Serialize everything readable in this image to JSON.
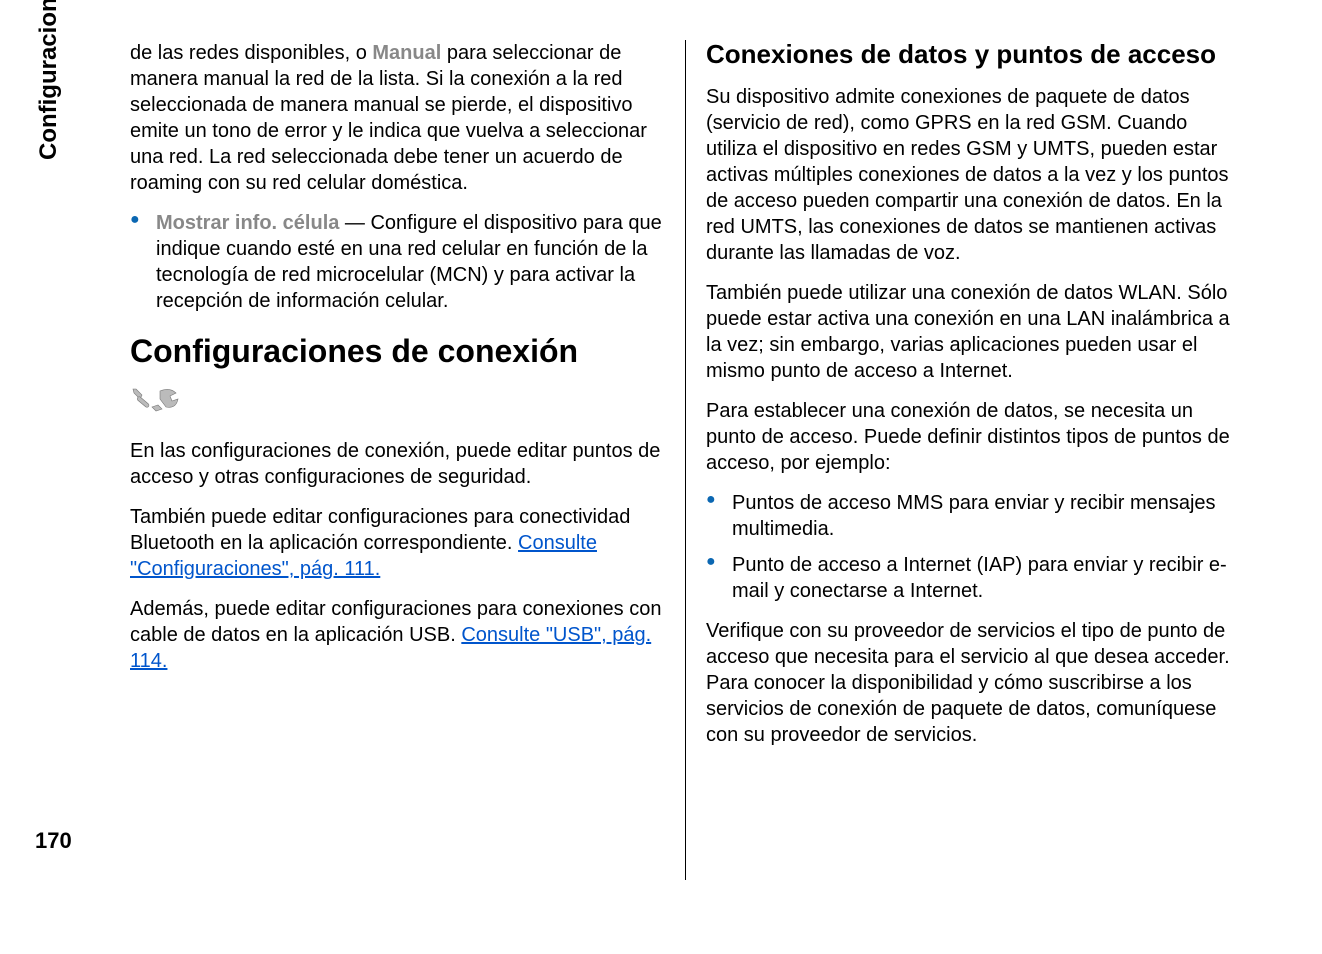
{
  "sideLabel": "Configuraciones",
  "pageNumber": "170",
  "left": {
    "introText1a": "de las redes disponibles, o ",
    "introManual": "Manual",
    "introText1b": " para seleccionar de manera manual la red de la lista. Si la conexión a la red seleccionada de manera manual se pierde, el dispositivo emite un tono de error y le indica que vuelva a seleccionar una red. La red seleccionada debe tener un acuerdo de roaming con su red celular doméstica.",
    "bullet1Label": "Mostrar info. célula",
    "bullet1Text": "  — Configure el dispositivo para que indique cuando esté en una red celular en función de la tecnología de red microcelular (MCN) y para activar la recepción de información celular.",
    "heading": "Configuraciones de conexión",
    "p1": "En las configuraciones de conexión, puede editar puntos de acceso y otras configuraciones de seguridad.",
    "p2a": "También puede editar configuraciones para conectividad Bluetooth en la aplicación correspondiente. ",
    "p2link": "Consulte \"Configuraciones\", pág. 111.",
    "p3a": "Además, puede editar configuraciones para conexiones con cable de datos en la aplicación USB. ",
    "p3link": "Consulte \"USB\", pág. 114."
  },
  "right": {
    "heading": "Conexiones de datos y puntos de acceso",
    "p1": "Su dispositivo admite conexiones de paquete de datos (servicio de red), como GPRS en la red GSM. Cuando utiliza el dispositivo en redes GSM y UMTS, pueden estar activas múltiples conexiones de datos a la vez y los puntos de acceso pueden compartir una conexión de datos. En la red UMTS, las conexiones de datos se mantienen activas durante las llamadas de voz.",
    "p2": "También puede utilizar una conexión de datos WLAN. Sólo puede estar activa una conexión en una LAN inalámbrica a la vez; sin embargo, varias aplicaciones pueden usar el mismo punto de acceso a Internet.",
    "p3": "Para establecer una conexión de datos, se necesita un punto de acceso. Puede definir distintos tipos de puntos de acceso, por ejemplo:",
    "bullets": [
      "Puntos de acceso MMS para enviar y recibir mensajes multimedia.",
      "Punto de acceso a Internet (IAP) para enviar y recibir e-mail y conectarse a Internet."
    ],
    "p4": "Verifique con su proveedor de servicios el tipo de punto de acceso que necesita para el servicio al que desea acceder. Para conocer la disponibilidad y cómo suscribirse a los servicios de conexión de paquete de datos, comuníquese con su proveedor de servicios."
  }
}
